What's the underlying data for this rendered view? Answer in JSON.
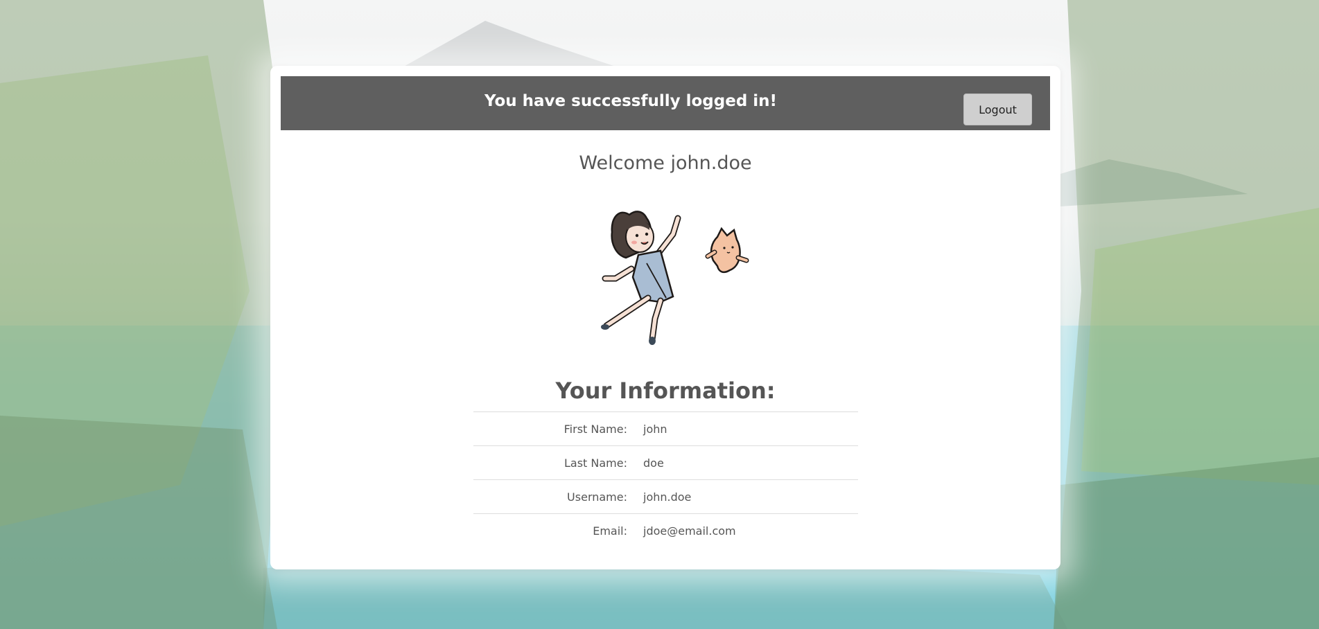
{
  "header": {
    "banner_title": "You have successfully logged in!",
    "logout_label": "Logout"
  },
  "main": {
    "welcome": "Welcome john.doe",
    "info_title": "Your Information:",
    "fields": [
      {
        "label": "First Name:",
        "value": "john"
      },
      {
        "label": "Last Name:",
        "value": "doe"
      },
      {
        "label": "Username:",
        "value": "john.doe"
      },
      {
        "label": "Email:",
        "value": "jdoe@email.com"
      }
    ]
  },
  "colors": {
    "banner": "#5f5f5f",
    "button": "#cfcfcf",
    "text": "#555555"
  },
  "icons": {
    "illustration": "girl-and-cat-illustration",
    "background": "mountain-lake-forest-photo"
  }
}
